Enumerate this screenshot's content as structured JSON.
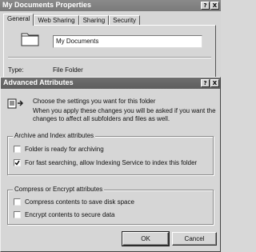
{
  "props_window": {
    "title": "My Documents Properties",
    "title_buttons": [
      "?",
      "X"
    ],
    "tabs": [
      "General",
      "Web Sharing",
      "Sharing",
      "Security"
    ],
    "active_tab": "General",
    "folder_name": "My Documents",
    "type_label": "Type:",
    "type_value": "File Folder",
    "icon": "folder-icon"
  },
  "adv_dialog": {
    "title": "Advanced Attributes",
    "title_buttons": [
      "?",
      "X"
    ],
    "intro": "Choose the settings you want for this folder",
    "intro_detail": "When you apply these changes you will be asked if you want the changes to affect all subfolders and files as well.",
    "icon": "attributes-icon",
    "groups": [
      {
        "title": "Archive and Index attributes",
        "options": [
          {
            "label": "Folder is ready for archiving",
            "checked": false
          },
          {
            "label": "For fast searching, allow Indexing Service to index this folder",
            "checked": true
          }
        ]
      },
      {
        "title": "Compress or Encrypt attributes",
        "options": [
          {
            "label": "Compress contents to save disk space",
            "checked": false
          },
          {
            "label": "Encrypt contents to secure data",
            "checked": false
          }
        ]
      }
    ],
    "ok_label": "OK",
    "cancel_label": "Cancel"
  }
}
